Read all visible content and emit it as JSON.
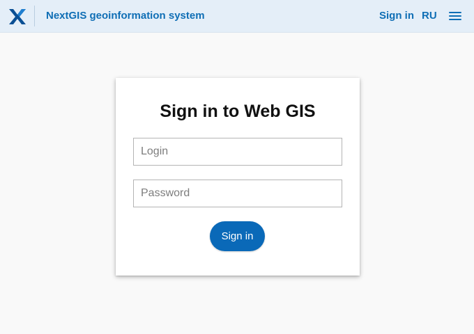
{
  "header": {
    "logo_icon": "nextgis-x-logo",
    "title": "NextGIS geoinformation system",
    "sign_in_label": "Sign in",
    "language_label": "RU",
    "menu_icon": "hamburger-menu-icon",
    "background_color": "#e4eef8",
    "accent_color": "#0f6eb5"
  },
  "login_form": {
    "title": "Sign in to Web GIS",
    "login_placeholder": "Login",
    "login_value": "",
    "password_placeholder": "Password",
    "password_value": "",
    "submit_label": "Sign in",
    "button_color": "#0a69b8"
  }
}
